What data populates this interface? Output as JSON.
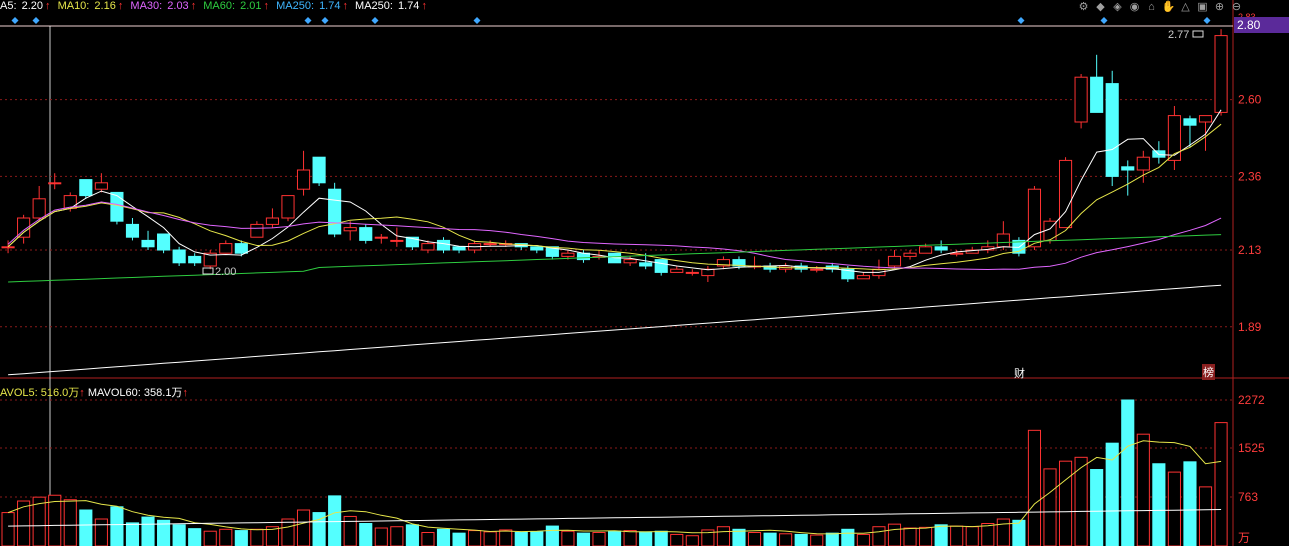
{
  "legend": {
    "ma5": {
      "label": "A5: ",
      "value": "2.20",
      "color": "#ffffff"
    },
    "ma10": {
      "label": "MA10: ",
      "value": "2.16",
      "color": "#e6e64a"
    },
    "ma30": {
      "label": "MA30: ",
      "value": "2.03",
      "color": "#e066ff"
    },
    "ma60": {
      "label": "MA60: ",
      "value": "2.01",
      "color": "#2ecc40"
    },
    "ma250a": {
      "label": "MA250: ",
      "value": "1.74",
      "color": "#3fb6ff"
    },
    "ma250b": {
      "label": "MA250: ",
      "value": "1.74",
      "color": "#ffffff"
    },
    "arrow": "↑"
  },
  "volume_legend": {
    "mavol5": {
      "label": "AVOL5: ",
      "value": "516.0万",
      "color": "#e6e64a"
    },
    "mavol60": {
      "label": "MAVOL60: ",
      "value": "358.1万",
      "color": "#ffffff"
    },
    "arrow": "↑"
  },
  "toolbar": [
    "⚙",
    "◆",
    "◈",
    "◉",
    "⌂",
    "✋",
    "△",
    "▣",
    "⊕",
    "⊖"
  ],
  "price_tag": "2.80",
  "annotations": {
    "high_label": "2.77",
    "low_label": "2.00",
    "fin_badge": "财",
    "rank_badge": "榜",
    "top_right_tick": "2.83"
  },
  "chart_data": {
    "type": "candlestick",
    "price_axis": {
      "ticks": [
        "2.60",
        "2.36",
        "2.13",
        "1.89"
      ],
      "ylim": [
        1.73,
        2.83
      ]
    },
    "volume_axis": {
      "ticks": [
        "2272",
        "1525",
        "763"
      ],
      "unit": "万",
      "ylim": [
        0,
        2272
      ]
    },
    "colors": {
      "up": "#ff3232",
      "down": "#54ffff",
      "ma5": "#ffffff",
      "ma10": "#e6e64a",
      "ma30": "#e066ff",
      "ma60": "#2ecc40",
      "ma250": "#ffffff",
      "mavol5": "#e6e64a",
      "mavol60": "#ffffff"
    },
    "candles": [
      [
        2.14,
        2.14,
        2.16,
        2.12,
        520
      ],
      [
        2.17,
        2.23,
        2.24,
        2.15,
        700
      ],
      [
        2.23,
        2.29,
        2.33,
        2.22,
        760
      ],
      [
        2.34,
        2.34,
        2.37,
        2.32,
        790
      ],
      [
        2.26,
        2.3,
        2.31,
        2.25,
        720
      ],
      [
        2.35,
        2.3,
        2.35,
        2.29,
        560
      ],
      [
        2.32,
        2.34,
        2.37,
        2.31,
        420
      ],
      [
        2.31,
        2.22,
        2.31,
        2.21,
        610
      ],
      [
        2.21,
        2.17,
        2.23,
        2.16,
        360
      ],
      [
        2.16,
        2.14,
        2.19,
        2.13,
        450
      ],
      [
        2.18,
        2.13,
        2.18,
        2.12,
        400
      ],
      [
        2.13,
        2.09,
        2.14,
        2.08,
        330
      ],
      [
        2.11,
        2.09,
        2.12,
        2.08,
        270
      ],
      [
        2.08,
        2.12,
        2.13,
        2.07,
        230
      ],
      [
        2.12,
        2.15,
        2.16,
        2.12,
        260
      ],
      [
        2.15,
        2.12,
        2.16,
        2.11,
        240
      ],
      [
        2.17,
        2.21,
        2.22,
        2.17,
        260
      ],
      [
        2.21,
        2.23,
        2.26,
        2.2,
        300
      ],
      [
        2.23,
        2.3,
        2.3,
        2.22,
        420
      ],
      [
        2.32,
        2.38,
        2.44,
        2.3,
        560
      ],
      [
        2.42,
        2.34,
        2.42,
        2.33,
        520
      ],
      [
        2.32,
        2.18,
        2.34,
        2.17,
        780
      ],
      [
        2.19,
        2.2,
        2.22,
        2.16,
        460
      ],
      [
        2.2,
        2.16,
        2.21,
        2.15,
        350
      ],
      [
        2.17,
        2.17,
        2.18,
        2.15,
        280
      ],
      [
        2.16,
        2.16,
        2.2,
        2.14,
        300
      ],
      [
        2.17,
        2.14,
        2.17,
        2.13,
        330
      ],
      [
        2.13,
        2.15,
        2.16,
        2.12,
        210
      ],
      [
        2.16,
        2.13,
        2.17,
        2.12,
        260
      ],
      [
        2.14,
        2.13,
        2.14,
        2.12,
        200
      ],
      [
        2.13,
        2.15,
        2.16,
        2.12,
        240
      ],
      [
        2.15,
        2.15,
        2.16,
        2.14,
        220
      ],
      [
        2.15,
        2.15,
        2.16,
        2.14,
        250
      ],
      [
        2.15,
        2.14,
        2.15,
        2.13,
        210
      ],
      [
        2.14,
        2.13,
        2.14,
        2.12,
        220
      ],
      [
        2.14,
        2.11,
        2.14,
        2.1,
        310
      ],
      [
        2.11,
        2.12,
        2.13,
        2.1,
        230
      ],
      [
        2.12,
        2.1,
        2.13,
        2.09,
        200
      ],
      [
        2.11,
        2.11,
        2.13,
        2.1,
        210
      ],
      [
        2.12,
        2.09,
        2.12,
        2.09,
        230
      ],
      [
        2.09,
        2.1,
        2.11,
        2.08,
        240
      ],
      [
        2.09,
        2.08,
        2.12,
        2.07,
        220
      ],
      [
        2.1,
        2.06,
        2.1,
        2.05,
        230
      ],
      [
        2.06,
        2.07,
        2.08,
        2.06,
        180
      ],
      [
        2.06,
        2.06,
        2.07,
        2.05,
        160
      ],
      [
        2.05,
        2.07,
        2.08,
        2.03,
        250
      ],
      [
        2.08,
        2.1,
        2.11,
        2.07,
        300
      ],
      [
        2.1,
        2.08,
        2.11,
        2.07,
        260
      ],
      [
        2.08,
        2.08,
        2.11,
        2.07,
        210
      ],
      [
        2.08,
        2.07,
        2.09,
        2.06,
        200
      ],
      [
        2.07,
        2.08,
        2.09,
        2.06,
        190
      ],
      [
        2.08,
        2.07,
        2.09,
        2.06,
        180
      ],
      [
        2.07,
        2.07,
        2.08,
        2.06,
        170
      ],
      [
        2.08,
        2.07,
        2.09,
        2.06,
        200
      ],
      [
        2.07,
        2.04,
        2.08,
        2.03,
        260
      ],
      [
        2.04,
        2.05,
        2.06,
        2.04,
        180
      ],
      [
        2.05,
        2.07,
        2.1,
        2.04,
        300
      ],
      [
        2.08,
        2.11,
        2.13,
        2.07,
        340
      ],
      [
        2.11,
        2.12,
        2.13,
        2.1,
        280
      ],
      [
        2.12,
        2.14,
        2.15,
        2.12,
        290
      ],
      [
        2.14,
        2.13,
        2.16,
        2.12,
        330
      ],
      [
        2.12,
        2.12,
        2.13,
        2.11,
        310
      ],
      [
        2.12,
        2.13,
        2.14,
        2.12,
        300
      ],
      [
        2.13,
        2.14,
        2.16,
        2.12,
        350
      ],
      [
        2.14,
        2.18,
        2.22,
        2.13,
        420
      ],
      [
        2.16,
        2.12,
        2.17,
        2.11,
        400
      ],
      [
        2.14,
        2.32,
        2.33,
        2.13,
        1800
      ],
      [
        2.16,
        2.22,
        2.23,
        2.15,
        1200
      ],
      [
        2.2,
        2.41,
        2.42,
        2.2,
        1320
      ],
      [
        2.53,
        2.67,
        2.68,
        2.51,
        1380
      ],
      [
        2.67,
        2.56,
        2.74,
        2.56,
        1190
      ],
      [
        2.65,
        2.36,
        2.69,
        2.33,
        1600
      ],
      [
        2.39,
        2.38,
        2.41,
        2.3,
        2272
      ],
      [
        2.38,
        2.42,
        2.44,
        2.34,
        1740
      ],
      [
        2.44,
        2.42,
        2.47,
        2.4,
        1280
      ],
      [
        2.41,
        2.55,
        2.58,
        2.38,
        1150
      ],
      [
        2.54,
        2.52,
        2.55,
        2.45,
        1310
      ],
      [
        2.53,
        2.55,
        2.55,
        2.44,
        920
      ],
      [
        2.56,
        2.8,
        2.82,
        2.55,
        1920
      ]
    ],
    "ma5_last": 2.2,
    "ma10_last": 2.16,
    "ma30_last": 2.03,
    "ma60_last": 2.01,
    "ma250_last": 1.74,
    "mavol5_last": 516.0,
    "mavol60_last": 358.1
  }
}
